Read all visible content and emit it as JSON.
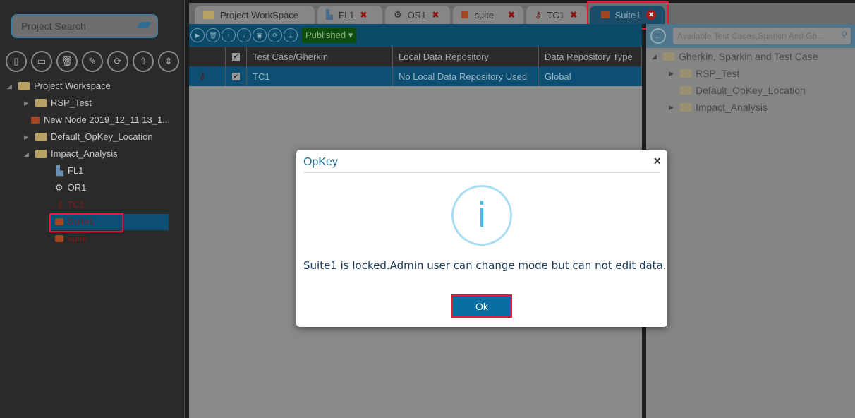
{
  "sidebar": {
    "search_placeholder": "Project Search",
    "tree": {
      "root": "Project Workspace",
      "items": [
        "RSP_Test",
        "New Node 2019_12_11 13_1...",
        "Default_OpKey_Location",
        "Impact_Analysis"
      ],
      "children": [
        "FL1",
        "OR1",
        "TC1",
        "Suite1",
        "suite"
      ]
    }
  },
  "tabs": [
    {
      "label": "Project WorkSpace"
    },
    {
      "label": "FL1"
    },
    {
      "label": "OR1"
    },
    {
      "label": "suite"
    },
    {
      "label": "TC1"
    },
    {
      "label": "Suite1"
    }
  ],
  "toolbar": {
    "status": "Published"
  },
  "table": {
    "headers": [
      "Test Case/Gherkin",
      "Local Data Repository",
      "Data Repository Type"
    ],
    "rows": [
      {
        "name": "TC1",
        "repo": "No Local Data Repository Used",
        "type": "Global"
      }
    ]
  },
  "right": {
    "search_placeholder": "Available Test Cases,Sparkin And Gh...",
    "root": "Gherkin, Sparkin and Test Case",
    "items": [
      "RSP_Test",
      "Default_OpKey_Location",
      "Impact_Analysis"
    ]
  },
  "dialog": {
    "title": "OpKey",
    "close": "×",
    "icon": "i",
    "message": "Suite1 is locked.Admin user can change mode but can not edit data.",
    "ok": "Ok"
  }
}
